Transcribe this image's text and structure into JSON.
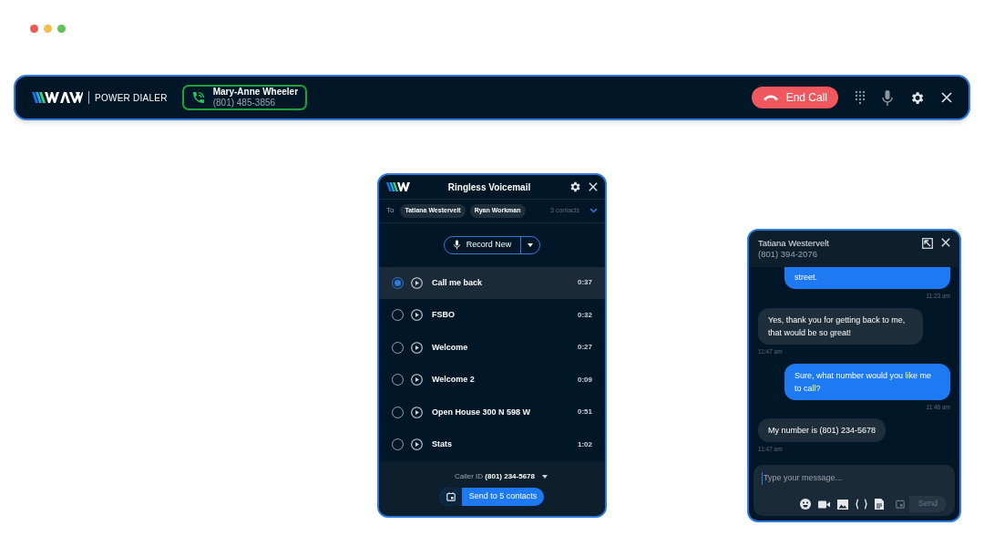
{
  "window": {
    "controls": [
      {
        "color": "#ee5a52"
      },
      {
        "color": "#f4be4f"
      },
      {
        "color": "#5fc35a"
      }
    ]
  },
  "dialer_bar": {
    "brand": "POWER DIALER",
    "contact": {
      "name": "Mary-Anne Wheeler",
      "phone": "(801) 485-3856"
    },
    "end_call": "End Call"
  },
  "voicemail": {
    "title": "Ringless Voicemail",
    "to_label": "To",
    "recipients": [
      "Tatiana Westervelt",
      "Ryan Workman"
    ],
    "contacts_count": "3 contacts",
    "record_button": "Record New",
    "items": [
      {
        "name": "Call me back",
        "duration": "0:37",
        "selected": true
      },
      {
        "name": "FSBO",
        "duration": "0:32",
        "selected": false
      },
      {
        "name": "Welcome",
        "duration": "0:27",
        "selected": false
      },
      {
        "name": "Welcome 2",
        "duration": "0:09",
        "selected": false
      },
      {
        "name": "Open House 300 N 598 W",
        "duration": "0:51",
        "selected": false
      },
      {
        "name": "Stats",
        "duration": "1:02",
        "selected": false
      }
    ],
    "caller_id_label": "Caller ID",
    "caller_id": "(801) 234-5678",
    "send_button": "Send to 5 contacts"
  },
  "chat": {
    "contact_name": "Tatiana Westervelt",
    "contact_phone": "(801) 394-2076",
    "messages": [
      {
        "kind": "outgoing",
        "text": "street.",
        "time": "11:23 am"
      },
      {
        "kind": "incoming",
        "text": "Yes, thank you for getting back to me, that would be so great!",
        "time": "11:47 am"
      },
      {
        "kind": "outgoing",
        "text": "Sure, what number would you like me to call?",
        "time": "11:46 am"
      },
      {
        "kind": "incoming",
        "text": "My number is (801) 234-5678",
        "time": "11:47 am"
      }
    ],
    "input": {
      "placeholder": "Type your message..."
    },
    "send_button": "Send"
  }
}
